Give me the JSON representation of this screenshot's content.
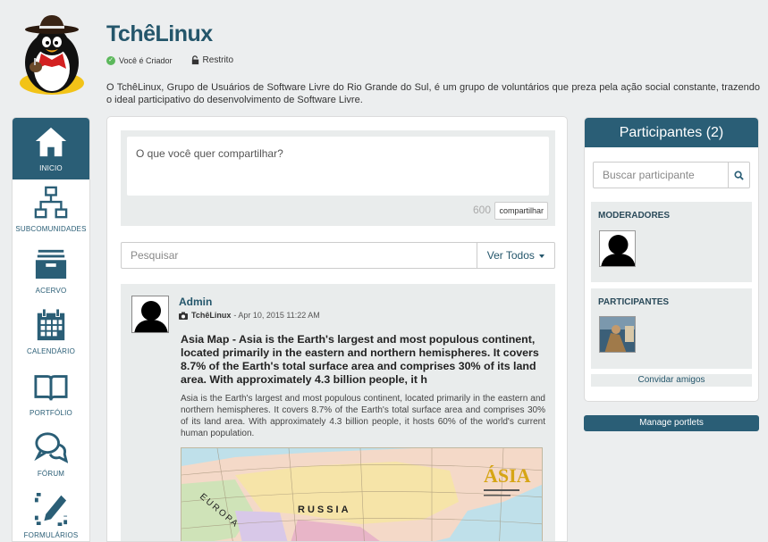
{
  "header": {
    "title": "TchêLinux",
    "creator_label": "Você é Criador",
    "access_label": "Restrito",
    "description": "O TchêLinux, Grupo de Usuários de Software Livre do Rio Grande do Sul, é um grupo de voluntários que preza pela ação social constante, trazendo o ideal participativo do desenvolvimento de Software Livre."
  },
  "nav": {
    "items": [
      {
        "label": "INICIO",
        "icon": "home-icon",
        "active": true
      },
      {
        "label": "SUBCOMUNIDADES",
        "icon": "sitemap-icon"
      },
      {
        "label": "ACERVO",
        "icon": "archive-icon"
      },
      {
        "label": "CALENDÁRIO",
        "icon": "calendar-icon"
      },
      {
        "label": "PORTFÓLIO",
        "icon": "book-icon"
      },
      {
        "label": "FÓRUM",
        "icon": "chat-icon"
      },
      {
        "label": "FORMULÁRIOS",
        "icon": "form-edit-icon"
      }
    ]
  },
  "share": {
    "placeholder": "O que você quer compartilhar?",
    "char_count": "600",
    "button_label": "compartilhar"
  },
  "filter": {
    "search_placeholder": "Pesquisar",
    "view_label": "Ver Todos"
  },
  "post": {
    "author": "Admin",
    "community": "TchêLinux",
    "date": "- Apr 10, 2015 11:22 AM",
    "title": "Asia Map - Asia is the Earth's largest and most populous continent, located primarily in the eastern and northern hemispheres. It covers 8.7% of the Earth's total surface area and comprises 30% of its land area. With approximately 4.3 billion people, it h",
    "body": "Asia is the Earth's largest and most populous continent, located primarily in the eastern and northern hemispheres. It covers 8.7% of the Earth's total surface area and comprises 30% of its land area. With approximately 4.3 billion people, it hosts 60% of the world's current human population.",
    "map_text": {
      "asia": "ÁSIA",
      "russia": "RUSSIA",
      "europa": "EUROPA"
    }
  },
  "participants": {
    "title": "Participantes (2)",
    "search_placeholder": "Buscar participante",
    "moderators_label": "MODERADORES",
    "participants_label": "PARTICIPANTES",
    "invite_label": "Convidar amigos"
  },
  "manage_label": "Manage portlets",
  "colors": {
    "brand": "#2a5e76",
    "title": "#24566b",
    "panel": "#e9ecec"
  }
}
